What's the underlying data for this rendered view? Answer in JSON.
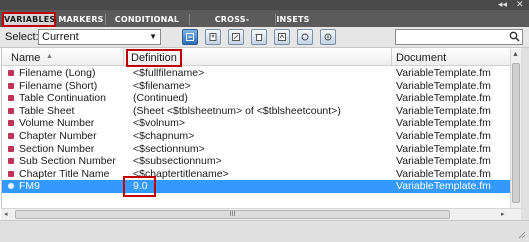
{
  "window": {
    "collapse_glyph": "◂◂",
    "close_glyph": "✕"
  },
  "tabs": [
    {
      "label": "VARIABLES",
      "active": true
    },
    {
      "label": "MARKERS",
      "active": false
    },
    {
      "label": "CONDITIONAL TEXT",
      "active": false
    },
    {
      "label": "CROSS-REFERENCES",
      "active": false
    },
    {
      "label": "INSETS",
      "active": false
    }
  ],
  "toolbar": {
    "select_label": "Select:",
    "select_value": "Current",
    "buttons": [
      "insert-variable-icon",
      "new-variable-icon",
      "edit-variable-icon",
      "delete-variable-icon",
      "update-icon",
      "refresh-icon",
      "convert-icon"
    ],
    "search_placeholder": ""
  },
  "table": {
    "headers": {
      "name": "Name",
      "definition": "Definition",
      "document": "Document"
    },
    "sort_glyph": "▲",
    "rows": [
      {
        "name": "Filename (Long)",
        "definition": "<$fullfilename>",
        "document": "VariableTemplate.fm"
      },
      {
        "name": "Filename (Short)",
        "definition": "<$filename>",
        "document": "VariableTemplate.fm"
      },
      {
        "name": "Table Continuation",
        "definition": "(Continued)",
        "document": "VariableTemplate.fm"
      },
      {
        "name": "Table Sheet",
        "definition": "(Sheet <$tblsheetnum> of <$tblsheetcount>)",
        "document": "VariableTemplate.fm"
      },
      {
        "name": "Volume Number",
        "definition": "<$volnum>",
        "document": "VariableTemplate.fm"
      },
      {
        "name": "Chapter Number",
        "definition": "<$chapnum>",
        "document": "VariableTemplate.fm"
      },
      {
        "name": "Section Number",
        "definition": "<$sectionnum>",
        "document": "VariableTemplate.fm"
      },
      {
        "name": "Sub Section Number",
        "definition": "<$subsectionnum>",
        "document": "VariableTemplate.fm"
      },
      {
        "name": "Chapter Title Name",
        "definition": "<$chaptertitlename>",
        "document": "VariableTemplate.fm"
      },
      {
        "name": "FM9",
        "definition": "9.0",
        "document": "VariableTemplate.fm",
        "selected": true
      }
    ]
  },
  "scroll": {
    "up": "▲",
    "down": "▼",
    "left": "◂",
    "right": "▸",
    "grip": "III"
  },
  "colors": {
    "highlight": "#c00000",
    "selection": "#3399ff",
    "tab_strip": "#5b5b5b"
  }
}
